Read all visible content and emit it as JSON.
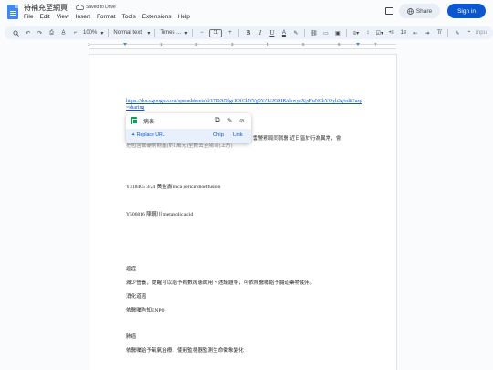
{
  "app": {
    "doc_title": "待補充至網頁",
    "saved_status": "Saved to Drive",
    "menu": [
      "File",
      "Edit",
      "View",
      "Insert",
      "Format",
      "Tools",
      "Extensions",
      "Help"
    ],
    "share_label": "Share",
    "signin_label": "Sign in"
  },
  "toolbar": {
    "zoom": "100%",
    "style": "Normal text",
    "font": "Times ...",
    "font_size": "11",
    "minus": "−",
    "plus": "+",
    "bold": "B",
    "italic": "I",
    "underline": "U",
    "text_color": "A",
    "extra": "ɪnpu"
  },
  "ruler": {
    "numbers": [
      "1",
      "1",
      "2",
      "3",
      "4",
      "5",
      "6",
      "7"
    ]
  },
  "document": {
    "link_text": "https://docs.google.com/spreadsheets/d/1TBXNfgr1OfCkNYg5YAUJGSIRAbwyeXjyPuNChYOyh3g/edit?usp=sharing",
    "para1_partial": "雲警察局同就醫 近日皆於行為異常，會",
    "para1_line2": "把包含軟硬幣財產(約1萬元)全數丟至陽台(上方)",
    "line_y318405": "Y318405 3/24  黃金壽 inca pericardioeffusion",
    "line_y506816": "Y506816 陳鋼川    metabolic acid",
    "heading_shuaibian": "癌症",
    "line_reduce": "減少營養，提醒可以給予病數病患飲用下述議題等，可依照醫囑給予腸道藥物使用。",
    "line_digest": "消化道癌",
    "line_advice": "依醫囑告知ENPO",
    "heading_breath": "肺癌",
    "line_oxygen": "依醫囑給予氧氣治療，使用監視器監測生命徵象變化"
  },
  "link_card": {
    "name": "病表",
    "replace_label": "Replace URL",
    "chip_label": "Chip",
    "link_label": "Link"
  }
}
